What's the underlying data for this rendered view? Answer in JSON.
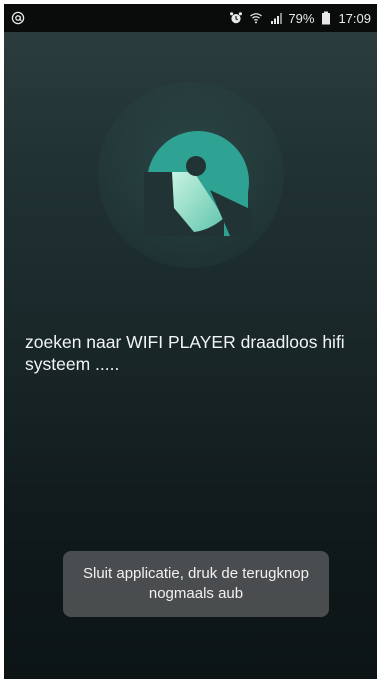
{
  "status_bar": {
    "left_icon": "at-sign-icon",
    "icons": [
      "alarm-icon",
      "wifi-icon",
      "signal-icon",
      "battery-icon"
    ],
    "battery_percent": "79%",
    "time": "17:09"
  },
  "main": {
    "logo_icon": "wifi-player-logo-icon",
    "message": "zoeken naar WIFI PLAYER draadloos hifi systeem ....."
  },
  "toast": {
    "text": "Sluit applicatie, druk de terugknop nogmaals aub"
  },
  "colors": {
    "logo_teal": "#2fa393",
    "logo_light": "#8fe0c8",
    "background_top": "#2a3c3d",
    "background_bottom": "#0c1416"
  }
}
